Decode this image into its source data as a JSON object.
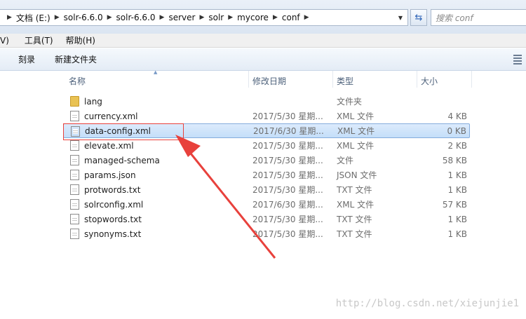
{
  "address": {
    "crumbs": [
      "文档 (E:)",
      "solr-6.6.0",
      "solr-6.6.0",
      "server",
      "solr",
      "mycore",
      "conf"
    ],
    "search_placeholder": "搜索 conf"
  },
  "menu": {
    "items": [
      "V)",
      "工具(T)",
      "帮助(H)"
    ]
  },
  "toolbar": {
    "burn": "刻录",
    "new_folder": "新建文件夹"
  },
  "columns": {
    "name": "名称",
    "date": "修改日期",
    "type": "类型",
    "size": "大小"
  },
  "files": [
    {
      "name": "lang",
      "date": "",
      "type": "文件夹",
      "size": "",
      "kind": "folder"
    },
    {
      "name": "currency.xml",
      "date": "2017/5/30 星期...",
      "type": "XML 文件",
      "size": "4 KB",
      "kind": "doc"
    },
    {
      "name": "data-config.xml",
      "date": "2017/6/30 星期...",
      "type": "XML 文件",
      "size": "0 KB",
      "kind": "doc",
      "selected": true
    },
    {
      "name": "elevate.xml",
      "date": "2017/5/30 星期...",
      "type": "XML 文件",
      "size": "2 KB",
      "kind": "doc"
    },
    {
      "name": "managed-schema",
      "date": "2017/5/30 星期...",
      "type": "文件",
      "size": "58 KB",
      "kind": "doc"
    },
    {
      "name": "params.json",
      "date": "2017/5/30 星期...",
      "type": "JSON 文件",
      "size": "1 KB",
      "kind": "doc"
    },
    {
      "name": "protwords.txt",
      "date": "2017/5/30 星期...",
      "type": "TXT 文件",
      "size": "1 KB",
      "kind": "doc"
    },
    {
      "name": "solrconfig.xml",
      "date": "2017/6/30 星期...",
      "type": "XML 文件",
      "size": "57 KB",
      "kind": "doc"
    },
    {
      "name": "stopwords.txt",
      "date": "2017/5/30 星期...",
      "type": "TXT 文件",
      "size": "1 KB",
      "kind": "doc"
    },
    {
      "name": "synonyms.txt",
      "date": "2017/5/30 星期...",
      "type": "TXT 文件",
      "size": "1 KB",
      "kind": "doc"
    }
  ],
  "watermark": "http://blog.csdn.net/xiejunjie1",
  "colors": {
    "annotation": "#e8413c",
    "selection": "#c4def9"
  }
}
